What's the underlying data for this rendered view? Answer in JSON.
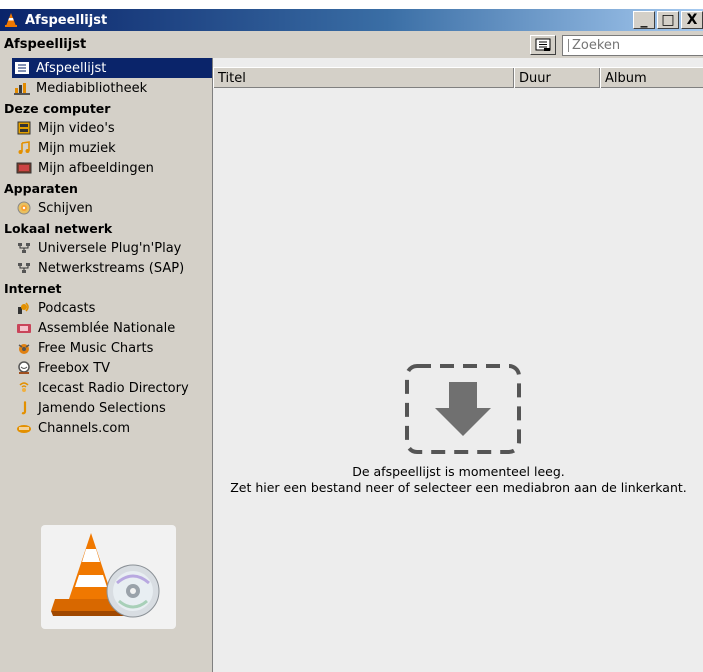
{
  "window": {
    "title": "Afspeellijst",
    "min": "_",
    "max": "□",
    "close": "X"
  },
  "header": {
    "title": "Afspeellijst",
    "search_placeholder": "Zoeken"
  },
  "sidebar": {
    "playlist": "Afspeellijst",
    "library": "Mediabibliotheek",
    "sections": [
      {
        "title": "Deze computer",
        "items": [
          "Mijn video's",
          "Mijn muziek",
          "Mijn afbeeldingen"
        ]
      },
      {
        "title": "Apparaten",
        "items": [
          "Schijven"
        ]
      },
      {
        "title": "Lokaal netwerk",
        "items": [
          "Universele Plug'n'Play",
          "Netwerkstreams (SAP)"
        ]
      },
      {
        "title": "Internet",
        "items": [
          "Podcasts",
          "Assemblée Nationale",
          "Free Music Charts",
          "Freebox TV",
          "Icecast Radio Directory",
          "Jamendo Selections",
          "Channels.com"
        ]
      }
    ]
  },
  "columns": [
    "Titel",
    "Duur",
    "Album"
  ],
  "empty": {
    "line1": "De afspeellijst is momenteel leeg.",
    "line2": "Zet hier een bestand neer of selecteer een mediabron aan de linkerkant."
  },
  "icons": [
    "vlc-cone-icon",
    "view-toggle-icon",
    "playlist-icon",
    "library-icon",
    "video-icon",
    "music-icon",
    "pictures-icon",
    "disc-icon",
    "network-icon",
    "podcast-icon",
    "tv-icon",
    "music-charts-icon",
    "freebox-icon",
    "icecast-icon",
    "jamendo-icon",
    "channels-icon",
    "drop-arrow-icon"
  ],
  "colors": {
    "selection": "#0a246a",
    "titlebar_start": "#0a246a",
    "titlebar_end": "#a6caf0",
    "cone": "#f07800"
  }
}
